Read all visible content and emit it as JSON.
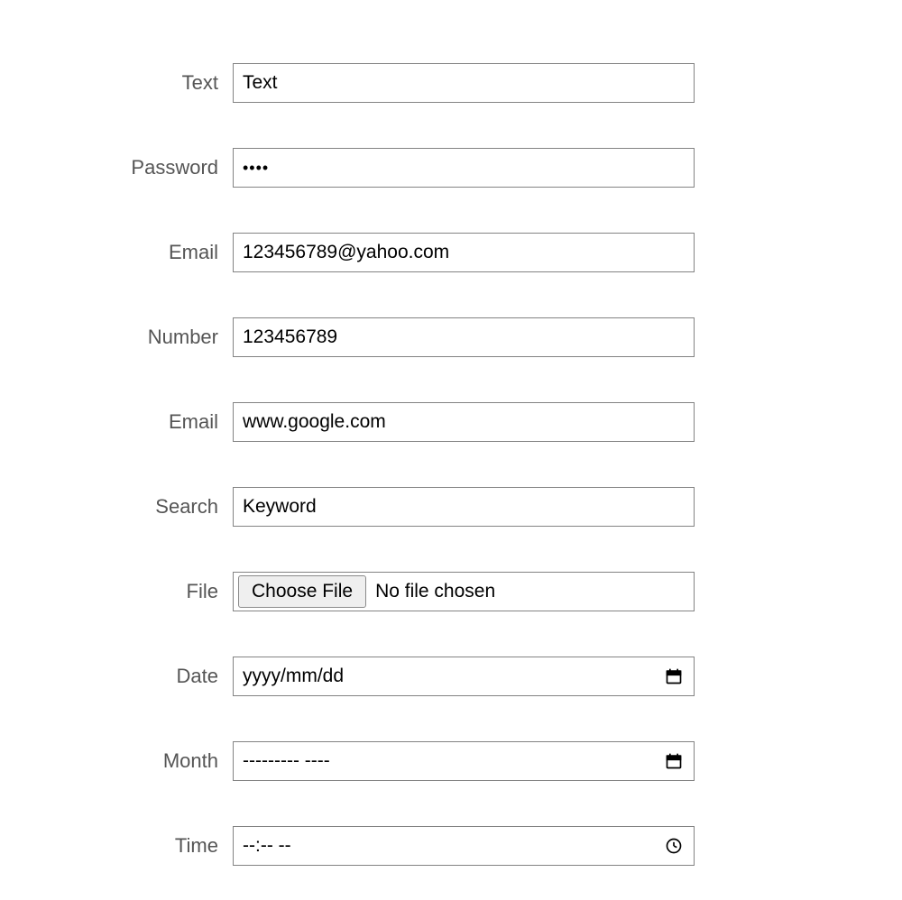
{
  "fields": {
    "text": {
      "label": "Text",
      "value": "Text"
    },
    "password": {
      "label": "Password",
      "value": "••••"
    },
    "email1": {
      "label": "Email",
      "value": "123456789@yahoo.com"
    },
    "number": {
      "label": "Number",
      "value": "123456789"
    },
    "email2": {
      "label": "Email",
      "value": "www.google.com"
    },
    "search": {
      "label": "Search",
      "value": "Keyword"
    },
    "file": {
      "label": "File",
      "button": "Choose File",
      "status": "No file chosen"
    },
    "date": {
      "label": "Date",
      "value": "yyyy/mm/dd"
    },
    "month": {
      "label": "Month",
      "value": "---------  ----"
    },
    "time": {
      "label": "Time",
      "value": "--:--  --"
    }
  }
}
